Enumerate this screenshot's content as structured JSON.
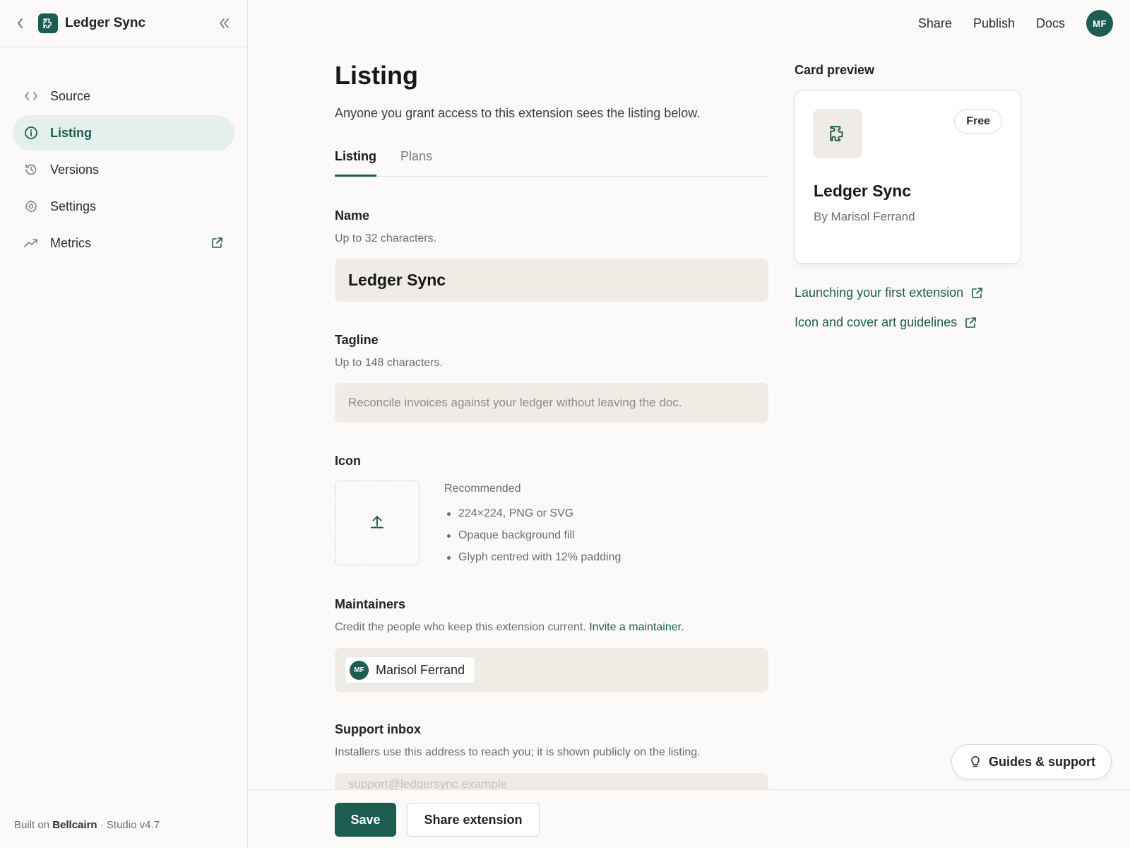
{
  "app": {
    "name": "Ledger Sync"
  },
  "sidebar": {
    "items": [
      {
        "label": "Source",
        "icon": "code-icon"
      },
      {
        "label": "Listing",
        "icon": "info-icon",
        "active": true
      },
      {
        "label": "Versions",
        "icon": "history-icon"
      },
      {
        "label": "Settings",
        "icon": "gear-icon"
      },
      {
        "label": "Metrics",
        "icon": "trend-icon",
        "external": true
      }
    ],
    "footer": {
      "prefix": "Built on ",
      "brand": "Bellcairn",
      "suffix": " · Studio v4.7"
    }
  },
  "topbar": {
    "links": [
      "Share",
      "Publish",
      "Docs"
    ],
    "avatar_initials": "MF"
  },
  "page": {
    "title": "Listing",
    "subtitle": "Anyone you grant access to this extension sees the listing below.",
    "tabs": [
      {
        "label": "Listing",
        "active": true
      },
      {
        "label": "Plans",
        "active": false
      }
    ]
  },
  "form": {
    "name": {
      "label": "Name",
      "help": "Up to 32 characters.",
      "value": "Ledger Sync"
    },
    "tagline": {
      "label": "Tagline",
      "help": "Up to 148 characters.",
      "placeholder": "Reconcile invoices against your ledger without leaving the doc."
    },
    "icon": {
      "label": "Icon",
      "recommended_title": "Recommended",
      "recommendations": [
        "224×224, PNG or SVG",
        "Opaque background fill",
        "Glyph centred with 12% padding"
      ]
    },
    "maintainers": {
      "label": "Maintainers",
      "help": "Credit the people who keep this extension current. ",
      "invite_link": "Invite a maintainer.",
      "people": [
        {
          "initials": "MF",
          "name": "Marisol Ferrand"
        }
      ]
    },
    "support": {
      "label": "Support inbox",
      "help": "Installers use this address to reach you; it is shown publicly on the listing.",
      "placeholder": "support@ledgersync.example"
    }
  },
  "actions": {
    "save": "Save",
    "share": "Share extension"
  },
  "preview": {
    "title": "Card preview",
    "badge": "Free",
    "name": "Ledger Sync",
    "by": "By Marisol Ferrand"
  },
  "help_links": [
    "Launching your first extension",
    "Icon and cover art guidelines"
  ],
  "guides_button": "Guides & support",
  "colors": {
    "accent": "#1d5c50",
    "active_nav_bg": "#e5efec",
    "input_bg": "#efebe5",
    "page_bg": "#fbfaf8"
  }
}
